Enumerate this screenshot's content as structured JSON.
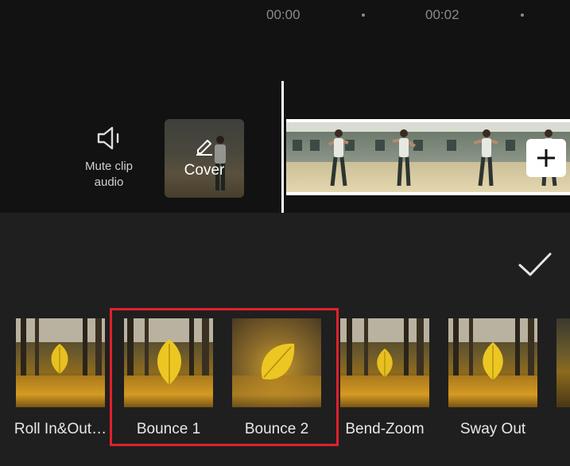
{
  "timeline": {
    "timecodes": [
      "00:00",
      "00:02"
    ]
  },
  "track_tools": {
    "mute_label": "Mute clip\naudio",
    "cover_label": "Cover"
  },
  "animations": {
    "items": [
      {
        "label": "Roll In&Out…"
      },
      {
        "label": "Bounce 1"
      },
      {
        "label": "Bounce 2"
      },
      {
        "label": "Bend-Zoom"
      },
      {
        "label": "Sway Out"
      }
    ]
  },
  "colors": {
    "highlight": "#e0212b",
    "panel_bg": "#1f1f1f",
    "top_bg": "#121212"
  },
  "icons": {
    "mute": "speaker-icon",
    "cover_edit": "pencil-icon",
    "add_clip": "plus-icon",
    "confirm": "checkmark-icon"
  }
}
